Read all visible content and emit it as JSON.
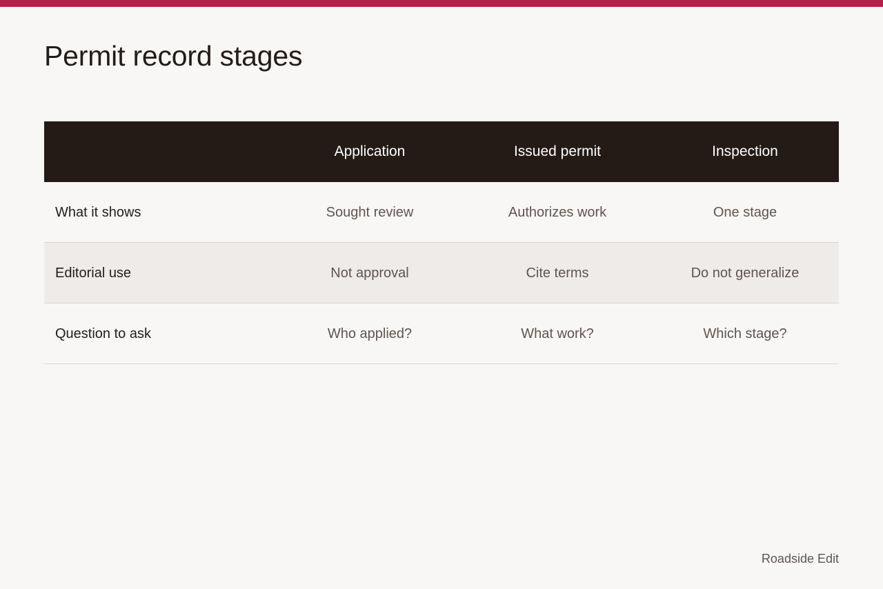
{
  "page": {
    "title": "Permit record stages",
    "accent_color": "#b81f4a",
    "header_bg": "#241b17",
    "alt_row_bg": "#efebe8"
  },
  "table": {
    "columns": [
      "Application",
      "Issued permit",
      "Inspection"
    ],
    "rows": [
      {
        "label": "What it shows",
        "values": [
          "Sought review",
          "Authorizes work",
          "One stage"
        ]
      },
      {
        "label": "Editorial use",
        "values": [
          "Not approval",
          "Cite terms",
          "Do not generalize"
        ]
      },
      {
        "label": "Question to ask",
        "values": [
          "Who applied?",
          "What work?",
          "Which stage?"
        ]
      }
    ]
  },
  "footer": {
    "brand": "Roadside Edit"
  }
}
